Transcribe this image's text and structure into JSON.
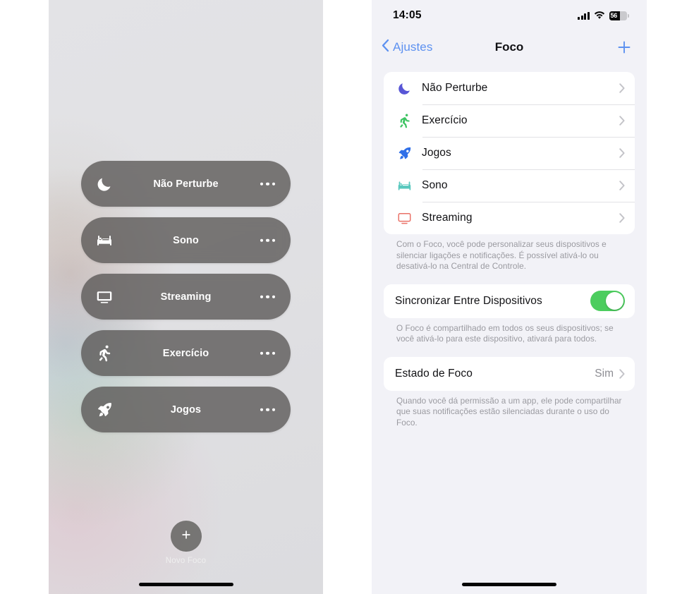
{
  "left_panel": {
    "name": "control-center-focus",
    "focus_pills": [
      {
        "label": "Não Perturbe",
        "icon": "moon-icon",
        "more": "more-options"
      },
      {
        "label": "Sono",
        "icon": "bed-icon",
        "more": "more-options"
      },
      {
        "label": "Streaming",
        "icon": "tv-icon",
        "more": "more-options"
      },
      {
        "label": "Exercício",
        "icon": "running-icon",
        "more": "more-options"
      },
      {
        "label": "Jogos",
        "icon": "rocket-icon",
        "more": "more-options"
      }
    ],
    "new_focus": {
      "label": "Novo Foco",
      "icon": "plus-icon"
    }
  },
  "right_panel": {
    "status_bar": {
      "time": "14:05",
      "signal_icon": "cellular-signal-icon",
      "wifi_icon": "wifi-icon",
      "battery_icon": "battery-icon",
      "battery_percent": "56"
    },
    "nav_bar": {
      "back_label": "Ajustes",
      "back_icon": "chevron-left-icon",
      "title": "Foco",
      "add_icon": "plus-icon"
    },
    "focus_list": [
      {
        "label": "Não Perturbe",
        "icon": "moon-icon",
        "color": "#5856d6",
        "chevron": "chevron-right-icon"
      },
      {
        "label": "Exercício",
        "icon": "running-icon",
        "color": "#3ec463",
        "chevron": "chevron-right-icon"
      },
      {
        "label": "Jogos",
        "icon": "rocket-icon",
        "color": "#2f6fe8",
        "chevron": "chevron-right-icon"
      },
      {
        "label": "Sono",
        "icon": "bed-icon",
        "color": "#58c8be",
        "chevron": "chevron-right-icon"
      },
      {
        "label": "Streaming",
        "icon": "tv-icon",
        "color": "#ea7268",
        "chevron": "chevron-right-icon"
      }
    ],
    "focus_list_footnote": "Com o Foco, você pode personalizar seus dispositivos e silenciar ligações e notificações. É possível ativá-lo ou desativá-lo na Central de Controle.",
    "sync_row": {
      "label": "Sincronizar Entre Dispositivos",
      "toggle_state": "on",
      "toggle_color": "#4ccd5e"
    },
    "sync_footnote": "O Foco é compartilhado em todos os seus dispositivos; se você ativá-lo para este dispositivo, ativará para todos.",
    "status_row": {
      "label": "Estado de Foco",
      "value": "Sim",
      "chevron": "chevron-right-icon"
    },
    "status_footnote": "Quando você dá permissão a um app, ele pode compartilhar que suas notificações estão silenciadas durante o uso do Foco."
  }
}
